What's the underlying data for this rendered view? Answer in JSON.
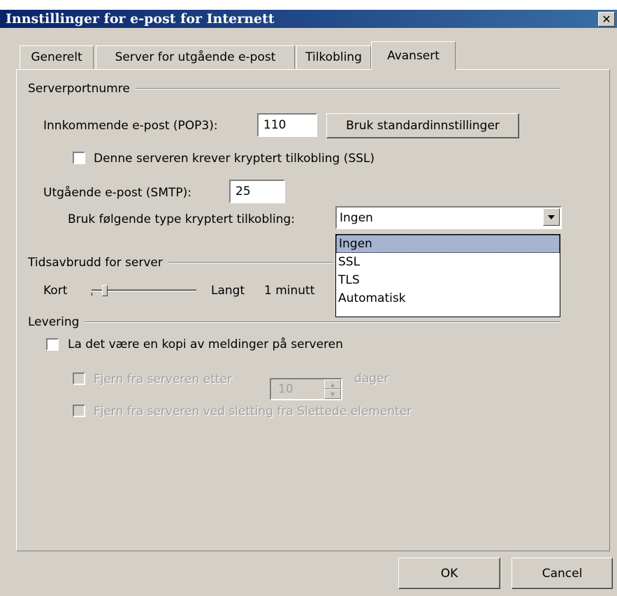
{
  "window": {
    "title": "Innstillinger for e-post for Internett",
    "close_label": "✕"
  },
  "tabs": [
    {
      "label": "Generelt"
    },
    {
      "label": "Server for utgående e-post"
    },
    {
      "label": "Tilkobling"
    },
    {
      "label": "Avansert"
    }
  ],
  "server_ports": {
    "group_label": "Serverportnumre",
    "incoming_label": "Innkommende e-post (POP3):",
    "incoming_value": "110",
    "default_button": "Bruk standardinnstillinger",
    "ssl_checkbox_label": "Denne serveren krever kryptert tilkobling (SSL)",
    "ssl_checked": false,
    "outgoing_label": "Utgående e-post (SMTP):",
    "outgoing_value": "25",
    "encryption_label": "Bruk følgende type kryptert tilkobling:",
    "encryption_value": "Ingen",
    "encryption_options": [
      "Ingen",
      "SSL",
      "TLS",
      "Automatisk"
    ],
    "encryption_selected_index": 0
  },
  "timeout": {
    "group_label": "Tidsavbrudd for server",
    "short_label": "Kort",
    "long_label": "Langt",
    "value_label": "1 minutt"
  },
  "delivery": {
    "group_label": "Levering",
    "keep_copy_label": "La det være en kopi av meldinger på serveren",
    "keep_copy_checked": false,
    "remove_after_label": "Fjern fra serveren etter",
    "remove_after_value": "10",
    "days_label": "dager",
    "remove_on_delete_label": "Fjern fra serveren ved sletting fra Slettede elementer"
  },
  "footer": {
    "ok_label": "OK",
    "cancel_label": "Cancel"
  },
  "colors": {
    "dialog_bg": "#d4d0c8",
    "titlebar": "#0a246a",
    "dropdown_selected": "#a5b4d0"
  }
}
